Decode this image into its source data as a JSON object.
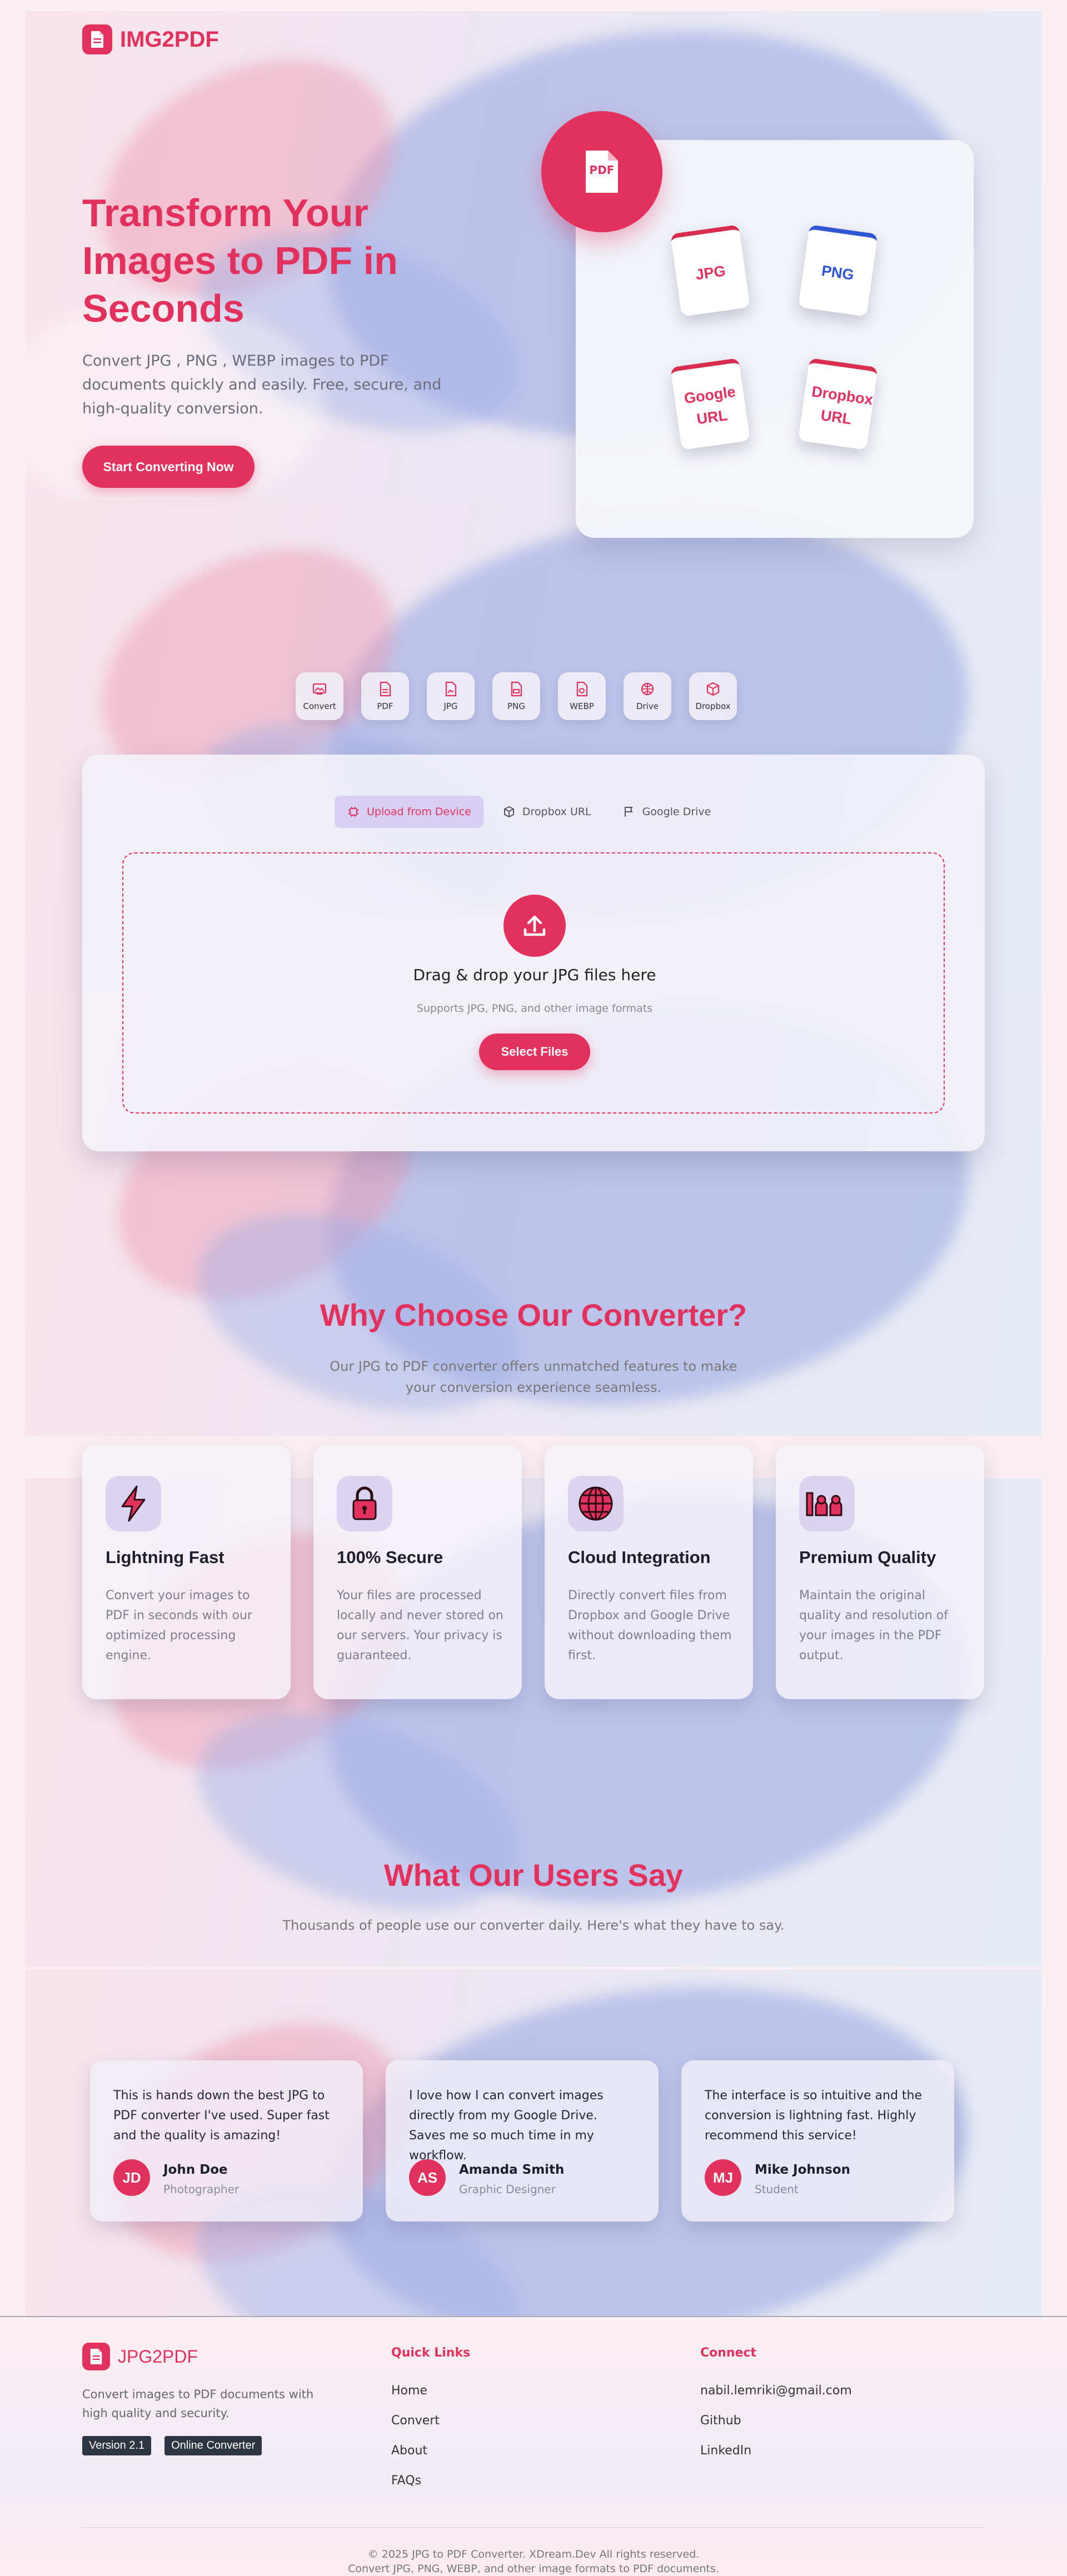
{
  "brand": {
    "name": "IMG2PDF"
  },
  "hero": {
    "title": "Transform Your Images to PDF in Seconds",
    "subtitle": "Convert JPG , PNG , WEBP images to PDF documents quickly and easily. Free, secure, and high-quality conversion.",
    "cta": "Start Converting Now",
    "pdf_badge": "PDF",
    "formats": [
      "JPG",
      "PNG",
      "Google URL",
      "Dropbox URL"
    ]
  },
  "tools": [
    "Convert",
    "PDF",
    "JPG",
    "PNG",
    "WEBP",
    "Drive",
    "Dropbox"
  ],
  "upload": {
    "tabs": [
      "Upload from Device",
      "Dropbox URL",
      "Google Drive"
    ],
    "drop_title": "Drag & drop your JPG files here",
    "drop_hint": "Supports JPG, PNG, and other image formats",
    "select_button": "Select Files"
  },
  "why": {
    "title": "Why Choose Our Converter?",
    "subtitle": "Our JPG to PDF converter offers unmatched features to make your conversion experience seamless.",
    "features": [
      {
        "icon": "lightning-icon",
        "title": "Lightning Fast",
        "text": "Convert your images to PDF in seconds with our optimized processing engine."
      },
      {
        "icon": "lock-icon",
        "title": "100% Secure",
        "text": "Your files are processed locally and never stored on our servers. Your privacy is guaranteed."
      },
      {
        "icon": "globe-icon",
        "title": "Cloud Integration",
        "text": "Directly convert files from Dropbox and Google Drive without downloading them first."
      },
      {
        "icon": "quality-icon",
        "title": "Premium Quality",
        "text": "Maintain the original quality and resolution of your images in the PDF output."
      }
    ]
  },
  "testimonials": {
    "title": "What Our Users Say",
    "subtitle": "Thousands of people use our converter daily. Here's what they have to say.",
    "items": [
      {
        "text": "This is hands down the best JPG to PDF converter I've used. Super fast and the quality is amazing!",
        "initials": "JD",
        "name": "John Doe",
        "role": "Photographer"
      },
      {
        "text": "I love how I can convert images directly from my Google Drive. Saves me so much time in my workflow.",
        "initials": "AS",
        "name": "Amanda Smith",
        "role": "Graphic Designer"
      },
      {
        "text": "The interface is so intuitive and the conversion is lightning fast. Highly recommend this service!",
        "initials": "MJ",
        "name": "Mike Johnson",
        "role": "Student"
      }
    ]
  },
  "footer": {
    "brand": "JPG2PDF",
    "description": "Convert images to PDF documents with high quality and security.",
    "badges": [
      "Version 2.1",
      "Online Converter"
    ],
    "quick_links_title": "Quick Links",
    "quick_links": [
      "Home",
      "Convert",
      "About",
      "FAQs"
    ],
    "connect_title": "Connect",
    "connect": [
      "nabil.lemriki@gmail.com",
      "Github",
      "LinkedIn"
    ],
    "copyright": "© 2025 JPG to PDF Converter. XDream.Dev All rights reserved.",
    "tagline": "Convert JPG, PNG, WEBP, and other image formats to PDF documents."
  },
  "colors": {
    "accent": "#e3315d",
    "blue": "#2f55d4",
    "text_dark": "#1d1d2b"
  }
}
